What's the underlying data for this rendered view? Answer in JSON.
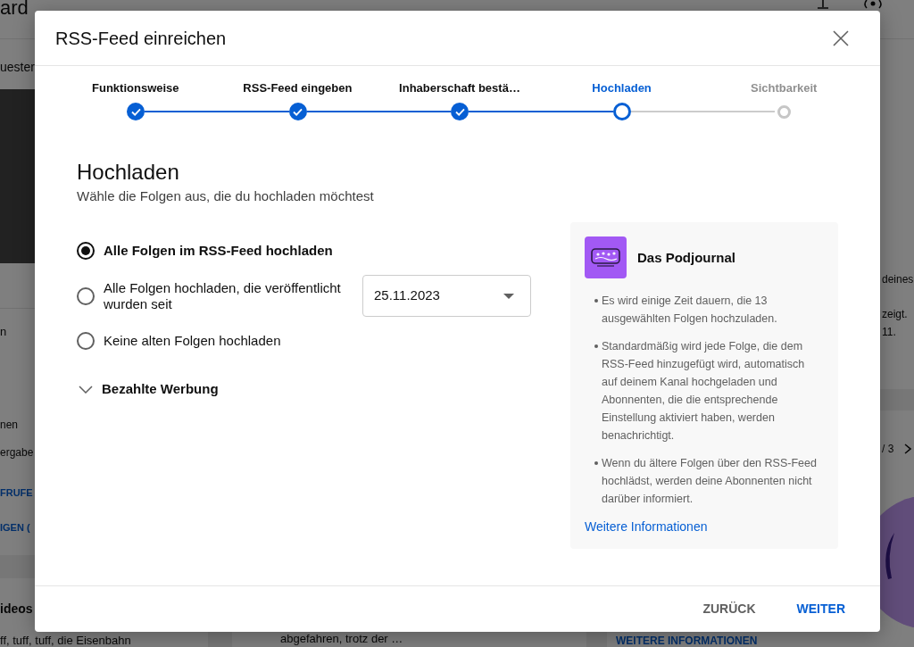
{
  "background_page": {
    "header": {
      "title": "ard"
    },
    "left_card": {
      "heading": "uester",
      "note": "n",
      "lines": [
        "nen",
        "ergabe"
      ],
      "links": [
        "FRUFE",
        "IGEN ("
      ]
    },
    "left_card_2": {
      "heading": "ideos",
      "text": "ff, tuff, tuff, die Eisenbahn"
    },
    "middle_card": {
      "text": "abgefahren, trotz der …"
    },
    "right_card": {
      "line": "deines",
      "lines": [
        "zeigt.",
        "11."
      ]
    },
    "right_card_2": {
      "pager": "/ 3",
      "link": "WEITERE INFORMATIONEN"
    }
  },
  "dialog": {
    "title": "RSS-Feed einreichen",
    "steps": [
      {
        "label": "Funktionsweise",
        "completed": true,
        "selected": false
      },
      {
        "label": "RSS-Feed eingeben",
        "completed": true,
        "selected": false
      },
      {
        "label": "Inhaberschaft bestä…",
        "completed": true,
        "selected": false
      },
      {
        "label": "Hochladen",
        "completed": false,
        "selected": true
      },
      {
        "label": "Sichtbarkeit",
        "completed": false,
        "selected": false
      }
    ],
    "heading": "Hochladen",
    "subtitle": "Wähle die Folgen aus, die du hochladen möchtest",
    "options": [
      {
        "label": "Alle Folgen im RSS-Feed hochladen",
        "selected": true
      },
      {
        "label": "Alle Folgen hochladen, die veröffentlicht wurden seit",
        "selected": false,
        "date": "25.11.2023"
      },
      {
        "label": "Keine alten Folgen hochladen",
        "selected": false
      }
    ],
    "section": {
      "label": "Bezahlte Werbung",
      "expanded": false
    },
    "podcast": {
      "name": "Das Podjournal",
      "notes": [
        "Es wird einige Zeit dauern, die 13 ausgewählten Folgen hochzuladen.",
        "Standardmäßig wird jede Folge, die dem RSS-Feed hinzugefügt wird, automatisch auf deinem Kanal hochgeladen und Abonnenten, die die entsprechende Einstellung aktiviert haben, werden benachrichtigt.",
        "Wenn du ältere Folgen über den RSS-Feed hochlädst, werden deine Abonnenten nicht darüber informiert."
      ],
      "link": "Weitere Informationen"
    },
    "buttons": [
      {
        "label": "ZURÜCK",
        "kind": "secondary"
      },
      {
        "label": "WEITER",
        "kind": "primary"
      }
    ]
  }
}
